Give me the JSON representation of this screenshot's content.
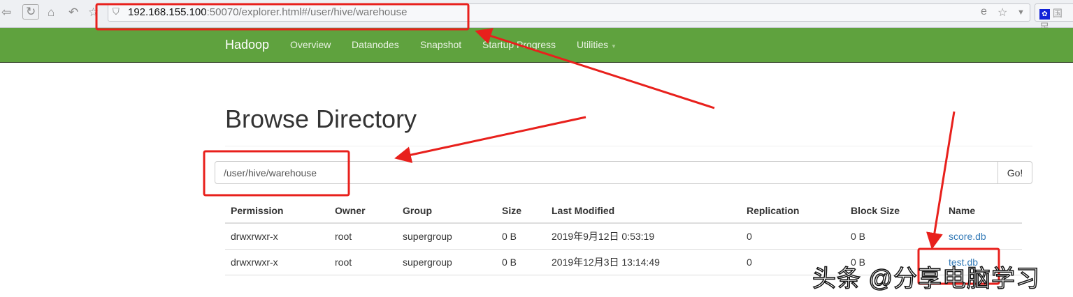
{
  "browser": {
    "url_host": "192.168.155.100",
    "url_rest": ":50070/explorer.html#/user/hive/warehouse",
    "bookmark": "国足"
  },
  "nav": {
    "brand": "Hadoop",
    "items": [
      "Overview",
      "Datanodes",
      "Snapshot",
      "Startup Progress",
      "Utilities"
    ]
  },
  "page": {
    "title": "Browse Directory",
    "path_value": "/user/hive/warehouse",
    "go_label": "Go!"
  },
  "table": {
    "headers": [
      "Permission",
      "Owner",
      "Group",
      "Size",
      "Last Modified",
      "Replication",
      "Block Size",
      "Name"
    ],
    "rows": [
      [
        "drwxrwxr-x",
        "root",
        "supergroup",
        "0 B",
        "2019年9月12日 0:53:19",
        "0",
        "0 B",
        "score.db"
      ],
      [
        "drwxrwxr-x",
        "root",
        "supergroup",
        "0 B",
        "2019年12月3日 13:14:49",
        "0",
        "0 B",
        "test.db"
      ]
    ]
  },
  "watermark": "头条 @分享电脑学习",
  "colors": {
    "navbar": "#5fa23e",
    "link": "#337ab7",
    "annotation": "#e8201c"
  }
}
